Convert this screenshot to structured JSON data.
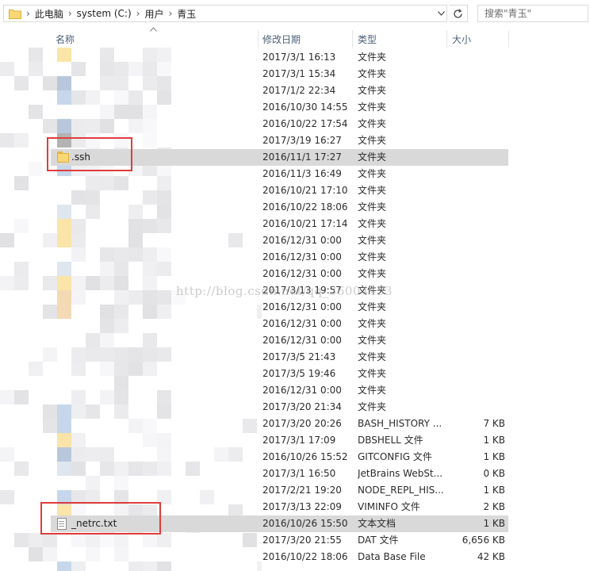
{
  "address_bar": {
    "crumbs": [
      "此电脑",
      "system (C:)",
      "用户",
      "青玉"
    ],
    "search_placeholder": "搜索\"青玉\""
  },
  "icons": {
    "address_folder": "folder-icon",
    "dropdown": "chevron-down-icon",
    "refresh": "refresh-icon",
    "sort": "sort-up-icon"
  },
  "columns": {
    "name": "名称",
    "date": "修改日期",
    "type": "类型",
    "size": "大小"
  },
  "rows": [
    {
      "name": "",
      "date": "2017/3/1 16:13",
      "type": "文件夹",
      "size": ""
    },
    {
      "name": "",
      "date": "2017/3/1 15:34",
      "type": "文件夹",
      "size": ""
    },
    {
      "name": "",
      "date": "2017/1/2 22:34",
      "type": "文件夹",
      "size": ""
    },
    {
      "name": "",
      "date": "2016/10/30 14:55",
      "type": "文件夹",
      "size": ""
    },
    {
      "name": "",
      "date": "2016/10/22 17:54",
      "type": "文件夹",
      "size": ""
    },
    {
      "name": "",
      "date": "2017/3/19 16:27",
      "type": "文件夹",
      "size": ""
    },
    {
      "name": ".ssh",
      "date": "2016/11/1 17:27",
      "type": "文件夹",
      "size": "",
      "selected": true,
      "icon": "folder-icon"
    },
    {
      "name": "",
      "date": "2016/11/3 16:49",
      "type": "文件夹",
      "size": ""
    },
    {
      "name": "",
      "date": "2016/10/21 17:10",
      "type": "文件夹",
      "size": ""
    },
    {
      "name": "",
      "date": "2016/10/22 18:06",
      "type": "文件夹",
      "size": ""
    },
    {
      "name": "",
      "date": "2016/10/21 17:14",
      "type": "文件夹",
      "size": ""
    },
    {
      "name": "",
      "date": "2016/12/31 0:00",
      "type": "文件夹",
      "size": ""
    },
    {
      "name": "",
      "date": "2016/12/31 0:00",
      "type": "文件夹",
      "size": ""
    },
    {
      "name": "",
      "date": "2016/12/31 0:00",
      "type": "文件夹",
      "size": ""
    },
    {
      "name": "",
      "date": "2017/3/13 19:57",
      "type": "文件夹",
      "size": ""
    },
    {
      "name": "",
      "date": "2016/12/31 0:00",
      "type": "文件夹",
      "size": ""
    },
    {
      "name": "",
      "date": "2016/12/31 0:00",
      "type": "文件夹",
      "size": ""
    },
    {
      "name": "",
      "date": "2016/12/31 0:00",
      "type": "文件夹",
      "size": ""
    },
    {
      "name": "",
      "date": "2017/3/5 21:43",
      "type": "文件夹",
      "size": ""
    },
    {
      "name": "",
      "date": "2017/3/5 19:46",
      "type": "文件夹",
      "size": ""
    },
    {
      "name": "",
      "date": "2016/12/31 0:00",
      "type": "文件夹",
      "size": ""
    },
    {
      "name": "",
      "date": "2017/3/20 21:34",
      "type": "文件夹",
      "size": ""
    },
    {
      "name": "",
      "date": "2017/3/20 20:26",
      "type": "BASH_HISTORY ...",
      "size": "7 KB"
    },
    {
      "name": "",
      "date": "2017/3/1 17:09",
      "type": "DBSHELL 文件",
      "size": "1 KB"
    },
    {
      "name": "",
      "date": "2016/10/26 15:52",
      "type": "GITCONFIG 文件",
      "size": "1 KB"
    },
    {
      "name": "",
      "date": "2017/3/1 16:50",
      "type": "JetBrains WebSt...",
      "size": "0 KB"
    },
    {
      "name": "",
      "date": "2017/2/21 19:20",
      "type": "NODE_REPL_HIS...",
      "size": "1 KB"
    },
    {
      "name": "",
      "date": "2017/3/13 22:09",
      "type": "VIMINFO 文件",
      "size": "2 KB"
    },
    {
      "name": "_netrc.txt",
      "date": "2016/10/26 15:50",
      "type": "文本文档",
      "size": "1 KB",
      "selected": true,
      "icon": "text-file-icon"
    },
    {
      "name": "",
      "date": "2017/3/20 21:55",
      "type": "DAT 文件",
      "size": "6,656 KB"
    },
    {
      "name": "",
      "date": "2016/10/22 18:06",
      "type": "Data Base File",
      "size": "42 KB"
    }
  ],
  "watermark": "http://blog.csdn.net/qq_36004453",
  "colors": {
    "selection": "#d9d9d9",
    "highlight_box": "#e03c3c",
    "folder": "#f8d775",
    "header_text": "#4c607a"
  }
}
